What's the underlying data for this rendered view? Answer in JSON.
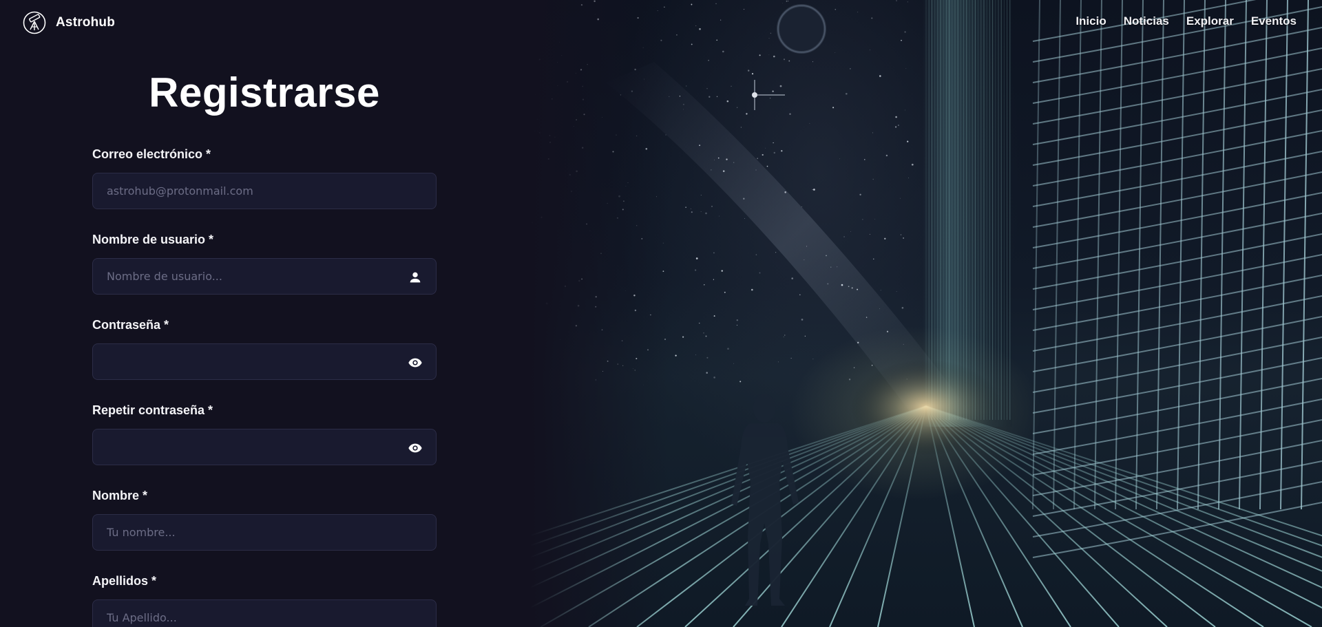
{
  "brand": {
    "name": "Astrohub",
    "logo_icon": "telescope-icon"
  },
  "nav": {
    "items": [
      {
        "label": "Inicio"
      },
      {
        "label": "Noticias"
      },
      {
        "label": "Explorar"
      },
      {
        "label": "Eventos"
      }
    ]
  },
  "form": {
    "title": "Registrarse",
    "fields": [
      {
        "label": "Correo electrónico *",
        "placeholder": "astrohub@protonmail.com",
        "value": "",
        "icon": null
      },
      {
        "label": "Nombre de usuario *",
        "placeholder": "Nombre de usuario...",
        "value": "",
        "icon": "user-icon"
      },
      {
        "label": "Contraseña *",
        "placeholder": "",
        "value": "",
        "icon": "eye-icon"
      },
      {
        "label": "Repetir contraseña *",
        "placeholder": "",
        "value": "",
        "icon": "eye-icon"
      },
      {
        "label": "Nombre *",
        "placeholder": "Tu nombre...",
        "value": "",
        "icon": null
      },
      {
        "label": "Apellidos *",
        "placeholder": "Tu Apellido...",
        "value": "",
        "icon": null
      }
    ]
  },
  "hero": {
    "image_icon": "astronaut-grid-illustration"
  },
  "colors": {
    "background": "#12111f",
    "input_background": "#191a2f",
    "input_border": "#2c2d47",
    "text": "#ffffff",
    "placeholder": "#6c6d86"
  }
}
